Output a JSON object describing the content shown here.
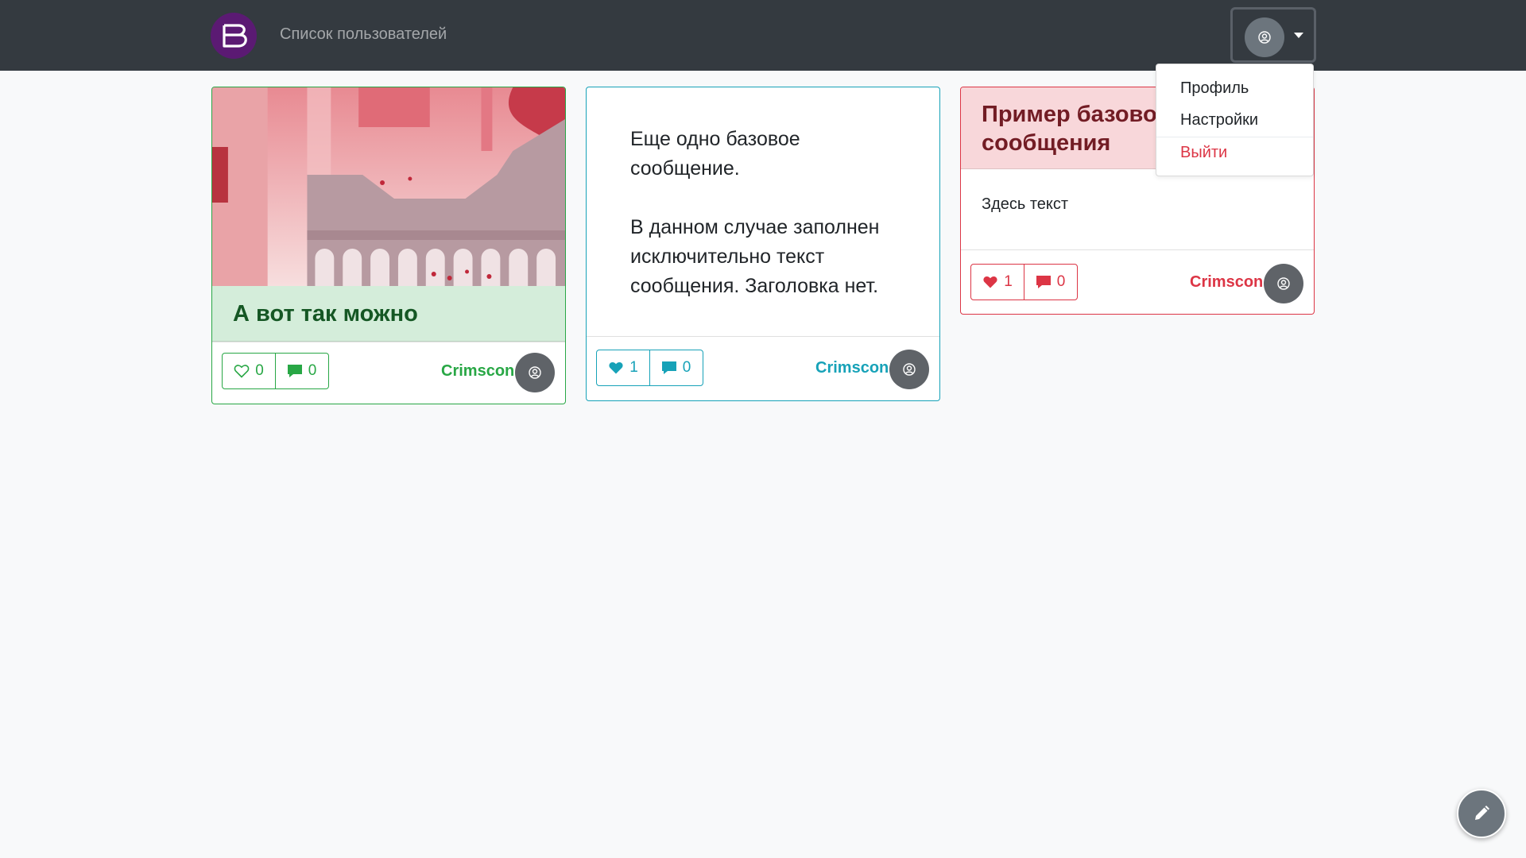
{
  "nav": {
    "users_link": "Список пользователей"
  },
  "user_menu": {
    "items": [
      {
        "label": "Профиль"
      },
      {
        "label": "Настройки"
      },
      {
        "label": "Выйти"
      }
    ]
  },
  "cards": [
    {
      "variant": "success",
      "title": "А вот так можно",
      "likes": "0",
      "comments": "0",
      "author": "Crimscon",
      "liked": false
    },
    {
      "variant": "info",
      "text_lines": [
        "Еще одно базовое",
        "сообщение.",
        "",
        "В данном случае заполнен",
        "исключительно текст",
        "сообщения. Заголовка нет."
      ],
      "likes": "1",
      "comments": "0",
      "author": "Crimscon",
      "liked": true
    },
    {
      "variant": "danger",
      "title_lines": [
        "Пример базово",
        "сообщения"
      ],
      "body": "Здесь текст",
      "likes": "1",
      "comments": "0",
      "author": "Crimscon",
      "liked": true
    }
  ],
  "colors": {
    "navbar": "#343a40",
    "success": "#28a745",
    "info": "#17a2b8",
    "danger": "#dc3545"
  }
}
